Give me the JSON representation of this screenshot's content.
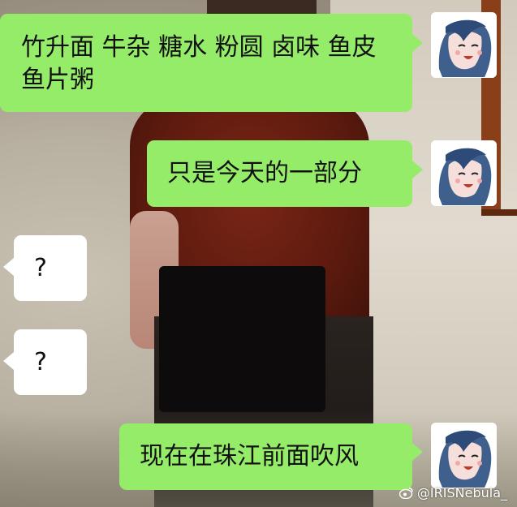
{
  "messages": [
    {
      "side": "right",
      "text": "竹升面 牛杂 糖水 粉圆 卤味 鱼皮 鱼片粥"
    },
    {
      "side": "right",
      "text": "只是今天的一部分"
    },
    {
      "side": "left",
      "text": "?"
    },
    {
      "side": "left",
      "text": "?"
    },
    {
      "side": "right",
      "text": "现在在珠江前面吹风"
    }
  ],
  "watermark": {
    "text": "@IRISNebula_",
    "icon": "weibo-logo-icon"
  },
  "colors": {
    "bubble_sent": "#95ec69",
    "bubble_received": "#ffffff",
    "text": "#111111"
  }
}
